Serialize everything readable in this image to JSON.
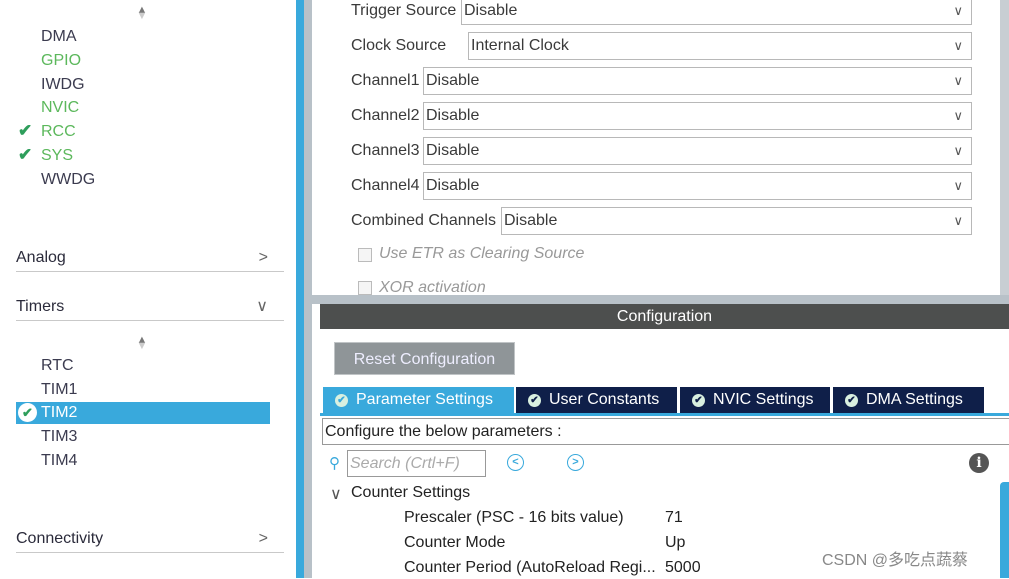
{
  "left_panel": {
    "peripherals": [
      {
        "label": "DMA",
        "status": "normal"
      },
      {
        "label": "GPIO",
        "status": "green"
      },
      {
        "label": "IWDG",
        "status": "normal"
      },
      {
        "label": "NVIC",
        "status": "green"
      },
      {
        "label": "RCC",
        "status": "checked"
      },
      {
        "label": "SYS",
        "status": "checked"
      },
      {
        "label": "WWDG",
        "status": "normal"
      }
    ],
    "categories": {
      "analog": "Analog",
      "timers": "Timers",
      "connectivity": "Connectivity"
    },
    "timers": [
      {
        "label": "RTC"
      },
      {
        "label": "TIM1"
      },
      {
        "label": "TIM2",
        "selected": true
      },
      {
        "label": "TIM3"
      },
      {
        "label": "TIM4"
      }
    ]
  },
  "mode": {
    "fields": [
      {
        "label": "Trigger Source",
        "value": "Disable"
      },
      {
        "label": "Clock Source",
        "value": "Internal Clock"
      },
      {
        "label": "Channel1",
        "value": "Disable"
      },
      {
        "label": "Channel2",
        "value": "Disable"
      },
      {
        "label": "Channel3",
        "value": "Disable"
      },
      {
        "label": "Channel4",
        "value": "Disable"
      },
      {
        "label": "Combined Channels",
        "value": "Disable"
      }
    ],
    "checkboxes": [
      {
        "label": "Use ETR as Clearing Source",
        "checked": false
      },
      {
        "label": "XOR activation",
        "checked": false
      }
    ]
  },
  "config": {
    "header": "Configuration",
    "reset_label": "Reset Configuration",
    "tabs": [
      {
        "label": "Parameter Settings",
        "active": true
      },
      {
        "label": "User Constants"
      },
      {
        "label": "NVIC Settings"
      },
      {
        "label": "DMA Settings"
      }
    ],
    "instructions": "Configure the below parameters :",
    "search_placeholder": "Search (Crtl+F)",
    "group": "Counter Settings",
    "params": [
      {
        "name": "Prescaler (PSC - 16 bits value)",
        "value": "71"
      },
      {
        "name": "Counter Mode",
        "value": "Up"
      },
      {
        "name": "Counter Period (AutoReload Regi...",
        "value": "5000"
      }
    ]
  },
  "watermark": "CSDN @多吃点蔬蔡",
  "colors": {
    "accent": "#39a9dc",
    "tab_dark": "#0f1f49",
    "green": "#5cb85c",
    "header": "#4d4f4e"
  }
}
